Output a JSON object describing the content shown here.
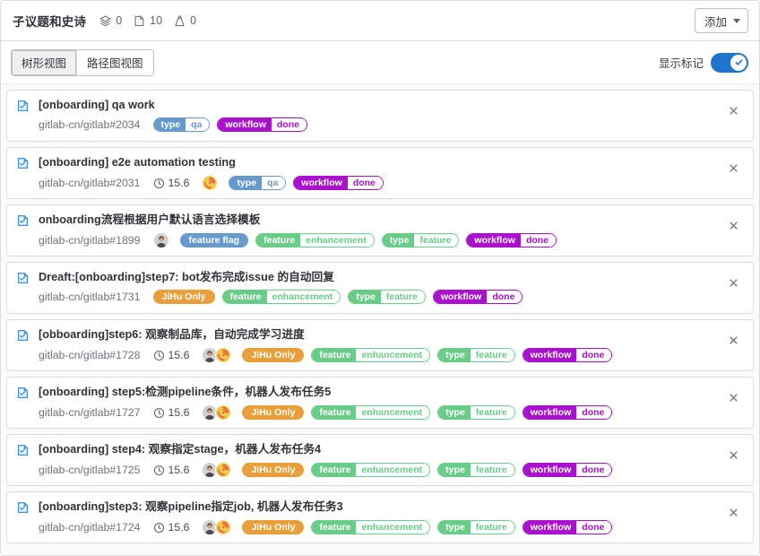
{
  "header": {
    "title": "子议题和史诗",
    "counters": [
      {
        "icon": "epic-icon",
        "value": "0"
      },
      {
        "icon": "issue-icon",
        "value": "10"
      },
      {
        "icon": "weight-icon",
        "value": "0"
      }
    ],
    "add_button": "添加"
  },
  "toolbar": {
    "views": [
      {
        "label": "树形视图",
        "active": true
      },
      {
        "label": "路径图视图",
        "active": false
      }
    ],
    "toggle_label": "显示标记",
    "toggle_on": true
  },
  "colors": {
    "accent_blue": "#1f75cb",
    "label_type_qa": "#6699cc",
    "label_workflow_done": "#aa11cc",
    "label_feature_flag": "#6699cc",
    "label_feature_enhancement": "#69cc88",
    "label_type_feature": "#69cc88",
    "label_jihu_only": "#e9a03c",
    "border": "#dcdcde",
    "text_muted": "#737278"
  },
  "rows": [
    {
      "title": "[onboarding] qa work",
      "ref": "gitlab-cn/gitlab#2034",
      "estimate": null,
      "avatars": [],
      "labels": [
        {
          "key": "type",
          "value": "qa",
          "color": "#6699cc",
          "scoped": true
        },
        {
          "key": "workflow",
          "value": "done",
          "color": "#aa11cc",
          "scoped": true
        }
      ]
    },
    {
      "title": "[onboarding] e2e automation testing",
      "ref": "gitlab-cn/gitlab#2031",
      "estimate": "15.6",
      "avatars": [
        "phone"
      ],
      "labels": [
        {
          "key": "type",
          "value": "qa",
          "color": "#6699cc",
          "scoped": true
        },
        {
          "key": "workflow",
          "value": "done",
          "color": "#aa11cc",
          "scoped": true
        }
      ]
    },
    {
      "title": "onboarding流程根据用户默认语言选择模板",
      "ref": "gitlab-cn/gitlab#1899",
      "estimate": null,
      "avatars": [
        "person"
      ],
      "labels": [
        {
          "key": "feature flag",
          "value": "",
          "color": "#6699cc",
          "scoped": false
        },
        {
          "key": "feature",
          "value": "enhancement",
          "color": "#69cc88",
          "scoped": true
        },
        {
          "key": "type",
          "value": "feature",
          "color": "#69cc88",
          "scoped": true
        },
        {
          "key": "workflow",
          "value": "done",
          "color": "#aa11cc",
          "scoped": true
        }
      ]
    },
    {
      "title": "Dreaft:[onboarding]step7: bot发布完成issue 的自动回复",
      "ref": "gitlab-cn/gitlab#1731",
      "estimate": null,
      "avatars": [],
      "labels": [
        {
          "key": "JiHu Only",
          "value": "",
          "color": "#e9a03c",
          "scoped": false
        },
        {
          "key": "feature",
          "value": "enhancement",
          "color": "#69cc88",
          "scoped": true
        },
        {
          "key": "type",
          "value": "feature",
          "color": "#69cc88",
          "scoped": true
        },
        {
          "key": "workflow",
          "value": "done",
          "color": "#aa11cc",
          "scoped": true
        }
      ]
    },
    {
      "title": "[obboarding]step6: 观察制品库，自动完成学习进度",
      "ref": "gitlab-cn/gitlab#1728",
      "estimate": "15.6",
      "avatars": [
        "person",
        "phone"
      ],
      "labels": [
        {
          "key": "JiHu Only",
          "value": "",
          "color": "#e9a03c",
          "scoped": false
        },
        {
          "key": "feature",
          "value": "enhancement",
          "color": "#69cc88",
          "scoped": true
        },
        {
          "key": "type",
          "value": "feature",
          "color": "#69cc88",
          "scoped": true
        },
        {
          "key": "workflow",
          "value": "done",
          "color": "#aa11cc",
          "scoped": true
        }
      ]
    },
    {
      "title": "[onboarding] step5:检测pipeline条件，机器人发布任务5",
      "ref": "gitlab-cn/gitlab#1727",
      "estimate": "15.6",
      "avatars": [
        "person",
        "phone"
      ],
      "labels": [
        {
          "key": "JiHu Only",
          "value": "",
          "color": "#e9a03c",
          "scoped": false
        },
        {
          "key": "feature",
          "value": "enhancement",
          "color": "#69cc88",
          "scoped": true
        },
        {
          "key": "type",
          "value": "feature",
          "color": "#69cc88",
          "scoped": true
        },
        {
          "key": "workflow",
          "value": "done",
          "color": "#aa11cc",
          "scoped": true
        }
      ]
    },
    {
      "title": "[onboarding] step4: 观察指定stage，机器人发布任务4",
      "ref": "gitlab-cn/gitlab#1725",
      "estimate": "15.6",
      "avatars": [
        "person",
        "phone"
      ],
      "labels": [
        {
          "key": "JiHu Only",
          "value": "",
          "color": "#e9a03c",
          "scoped": false
        },
        {
          "key": "feature",
          "value": "enhancement",
          "color": "#69cc88",
          "scoped": true
        },
        {
          "key": "type",
          "value": "feature",
          "color": "#69cc88",
          "scoped": true
        },
        {
          "key": "workflow",
          "value": "done",
          "color": "#aa11cc",
          "scoped": true
        }
      ]
    },
    {
      "title": "[onboarding]step3: 观察pipeline指定job, 机器人发布任务3",
      "ref": "gitlab-cn/gitlab#1724",
      "estimate": "15.6",
      "avatars": [
        "person",
        "phone"
      ],
      "labels": [
        {
          "key": "JiHu Only",
          "value": "",
          "color": "#e9a03c",
          "scoped": false
        },
        {
          "key": "feature",
          "value": "enhancement",
          "color": "#69cc88",
          "scoped": true
        },
        {
          "key": "type",
          "value": "feature",
          "color": "#69cc88",
          "scoped": true
        },
        {
          "key": "workflow",
          "value": "done",
          "color": "#aa11cc",
          "scoped": true
        }
      ]
    }
  ]
}
